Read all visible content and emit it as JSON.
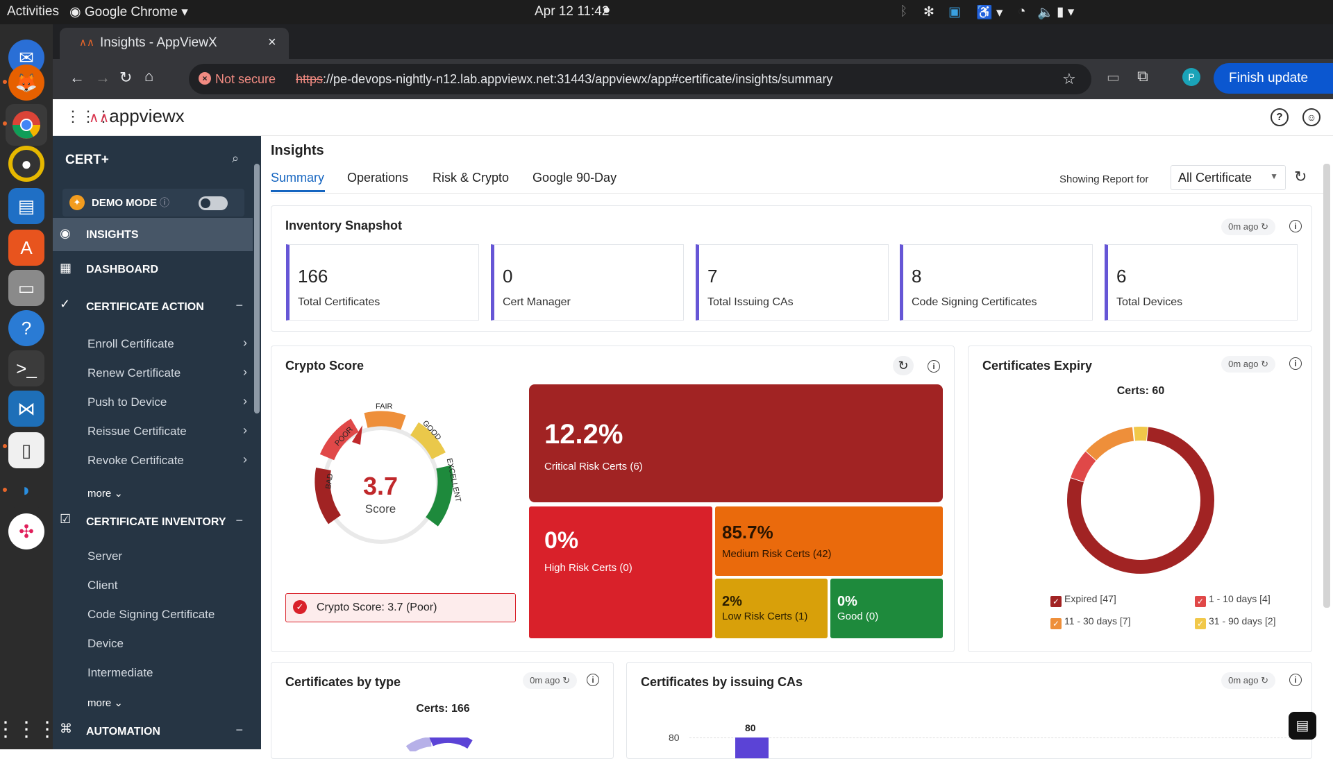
{
  "system": {
    "activities": "Activities",
    "app_name": "Google Chrome",
    "clock": "Apr 12  11:42"
  },
  "browser": {
    "tab_title": "Insights - AppViewX",
    "not_secure": "Not secure",
    "url_scheme": "https",
    "url_rest": "://pe-devops-nightly-n12.lab.appviewx.net:31443/appviewx/app#certificate/insights/summary",
    "profile_initial": "P",
    "finish_update": "Finish update"
  },
  "app": {
    "logo_text": "appviewx"
  },
  "sidebar": {
    "product": "CERT+",
    "demo_mode": "DEMO MODE",
    "items": [
      {
        "label": "INSIGHTS"
      },
      {
        "label": "DASHBOARD"
      },
      {
        "label": "CERTIFICATE ACTION"
      }
    ],
    "cert_action_items": [
      "Enroll Certificate",
      "Renew Certificate",
      "Push to Device",
      "Reissue Certificate",
      "Revoke Certificate"
    ],
    "more_1": "more",
    "inventory_label": "CERTIFICATE INVENTORY",
    "inventory_items": [
      "Server",
      "Client",
      "Code Signing Certificate",
      "Device",
      "Intermediate"
    ],
    "more_2": "more",
    "automation_label": "AUTOMATION"
  },
  "page": {
    "title": "Insights",
    "tabs": [
      "Summary",
      "Operations",
      "Risk & Crypto",
      "Google 90-Day"
    ],
    "showing_report_for": "Showing Report for",
    "report_select": "All Certificate"
  },
  "inventory": {
    "title": "Inventory Snapshot",
    "ago": "0m ago",
    "stats": [
      {
        "value": "166",
        "label": "Total Certificates"
      },
      {
        "value": "0",
        "label": "Cert Manager"
      },
      {
        "value": "7",
        "label": "Total Issuing CAs"
      },
      {
        "value": "8",
        "label": "Code Signing Certificates"
      },
      {
        "value": "6",
        "label": "Total Devices"
      }
    ]
  },
  "crypto": {
    "title": "Crypto Score",
    "score": "3.7",
    "score_label": "Score",
    "gauge_labels": [
      "BAD",
      "POOR",
      "FAIR",
      "GOOD",
      "EXCELLENT"
    ],
    "status": "Crypto Score: 3.7 (Poor)",
    "tiles": [
      {
        "pct": "12.2%",
        "label": "Critical Risk Certs (6)",
        "color": "#a12323"
      },
      {
        "pct": "0%",
        "label": "High Risk Certs (0)",
        "color": "#d9212a"
      },
      {
        "pct": "85.7%",
        "label": "Medium Risk Certs (42)",
        "color": "#ea6a0c"
      },
      {
        "pct": "2%",
        "label": "Low Risk Certs (1)",
        "color": "#d8a00a"
      },
      {
        "pct": "0%",
        "label": "Good (0)",
        "color": "#1e8a3c"
      }
    ]
  },
  "expiry": {
    "title": "Certificates Expiry",
    "ago": "0m ago",
    "total": "Certs: 60",
    "legend": [
      {
        "label": "Expired [47]",
        "color": "#a12323"
      },
      {
        "label": "1 - 10 days [4]",
        "color": "#e04848"
      },
      {
        "label": "11 - 30 days [7]",
        "color": "#ee8f3a"
      },
      {
        "label": "31 - 90 days [2]",
        "color": "#f1c84a"
      }
    ]
  },
  "chart_data": [
    {
      "type": "pie",
      "title": "Certs: 60",
      "categories": [
        "Expired",
        "1 - 10 days",
        "11 - 30 days",
        "31 - 90 days"
      ],
      "values": [
        47,
        4,
        7,
        2
      ],
      "colors": [
        "#a12323",
        "#e04848",
        "#ee8f3a",
        "#f1c84a"
      ]
    }
  ],
  "by_type": {
    "title": "Certificates by type",
    "ago": "0m ago",
    "total": "Certs: 166"
  },
  "by_ca": {
    "title": "Certificates by issuing CAs",
    "ago": "0m ago",
    "bar_label": "80",
    "y_tick": "80"
  }
}
